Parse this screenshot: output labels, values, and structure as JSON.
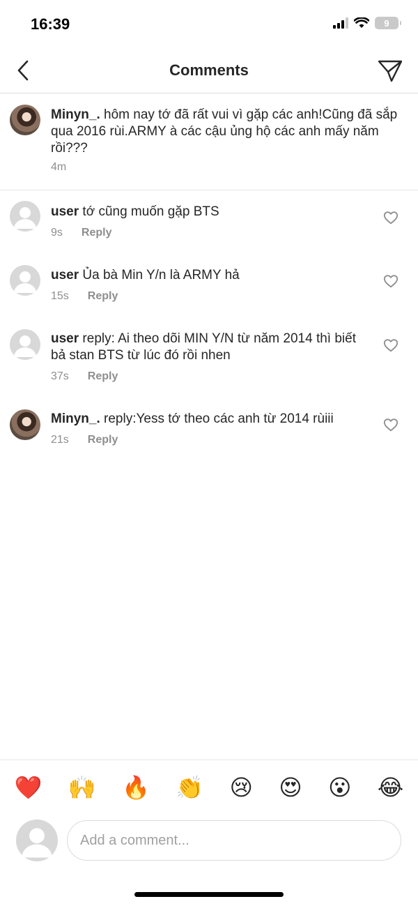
{
  "status": {
    "time": "16:39",
    "battery": "9"
  },
  "nav": {
    "title": "Comments",
    "back_icon": "chevron-left-icon",
    "send_icon": "paper-plane-icon"
  },
  "caption": {
    "username": "Minyn_.",
    "text": "hôm nay tớ đã rất vui vì gặp các anh!Cũng đã sắp qua 2016 rùi.ARMY à các cậu ủng hộ các anh mấy năm rồi???",
    "time": "4m"
  },
  "comments": [
    {
      "username": "user",
      "text": "tớ cũng muốn gặp BTS",
      "time": "9s",
      "reply_label": "Reply",
      "avatar": "default"
    },
    {
      "username": "user",
      "text": "Ủa bà Min Y/n là ARMY hả",
      "time": "15s",
      "reply_label": "Reply",
      "avatar": "default"
    },
    {
      "username": "user",
      "text": "reply: Ai theo dõi MIN Y/N từ năm 2014 thì biết bả stan BTS từ lúc đó rồi nhen",
      "time": "37s",
      "reply_label": "Reply",
      "avatar": "default"
    },
    {
      "username": "Minyn_.",
      "text": "reply:Yess tớ theo các anh từ 2014 rùiii",
      "time": "21s",
      "reply_label": "Reply",
      "avatar": "photo"
    }
  ],
  "emojis": [
    "❤️",
    "🙌",
    "🔥",
    "👏",
    "😢",
    "😍",
    "😮",
    "😂"
  ],
  "input": {
    "placeholder": "Add a comment..."
  },
  "colors": {
    "text": "#262626",
    "secondary": "#8e8e8e",
    "divider": "#dbdbdb"
  }
}
